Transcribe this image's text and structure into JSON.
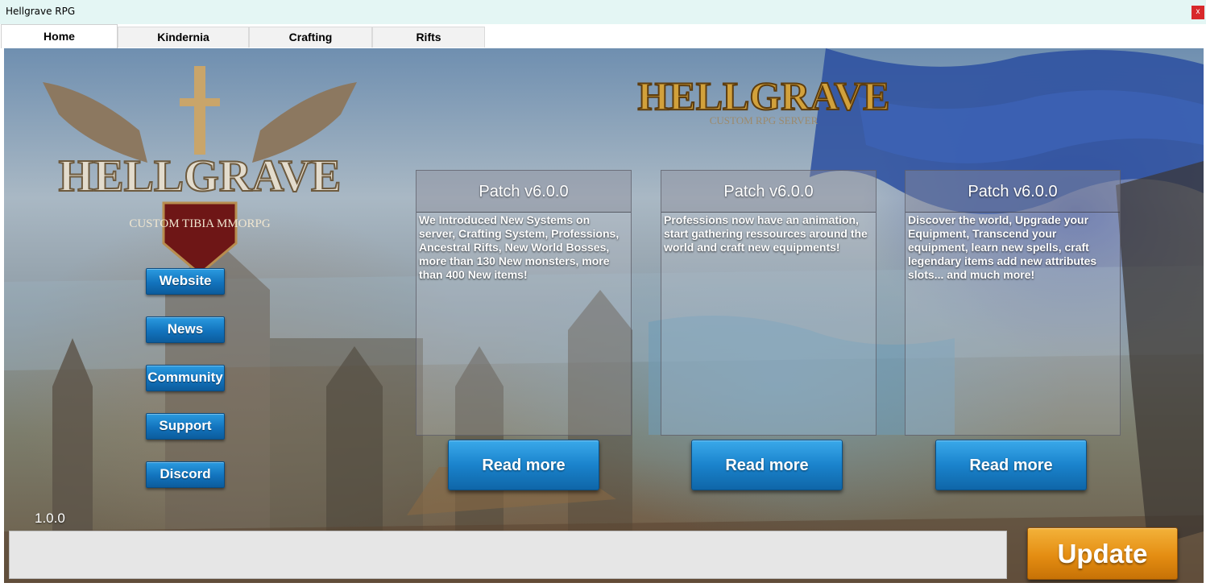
{
  "window": {
    "title": "Hellgrave RPG",
    "close_label": "x"
  },
  "tabs": [
    {
      "label": "Home",
      "active": true
    },
    {
      "label": "Kindernia",
      "active": false
    },
    {
      "label": "Crafting",
      "active": false
    },
    {
      "label": "Rifts",
      "active": false
    }
  ],
  "sidebar": {
    "website": "Website",
    "news": "News",
    "community": "Community",
    "support": "Support",
    "discord": "Discord"
  },
  "panels": [
    {
      "title": "Patch v6.0.0",
      "text": "We Introduced New Systems on server, Crafting System, Professions, Ancestral Rifts, New World Bosses, more than 130 New monsters, more than 400 New items!",
      "button": "Read more"
    },
    {
      "title": "Patch v6.0.0",
      "text": "Professions now have an animation, start gathering ressources around the world and craft new equipments!",
      "button": "Read more"
    },
    {
      "title": "Patch v6.0.0",
      "text": "Discover the world, Upgrade your Equipment, Transcend your equipment, learn new spells, craft legendary items add new attributes slots... and much more!",
      "button": "Read more"
    }
  ],
  "logos": {
    "main_title": "HELLGRAVE",
    "main_subtitle": "CUSTOM TIBIA MMORPG",
    "top_title": "HELLGRAVE",
    "top_subtitle": "CUSTOM RPG SERVER"
  },
  "footer": {
    "version": "1.0.0",
    "progress": 0,
    "update_label": "Update"
  },
  "colors": {
    "button_blue": "#1a83cc",
    "update_orange": "#e48d12",
    "titlebar_bg": "#e4f6f4",
    "close_red": "#d8292b"
  }
}
